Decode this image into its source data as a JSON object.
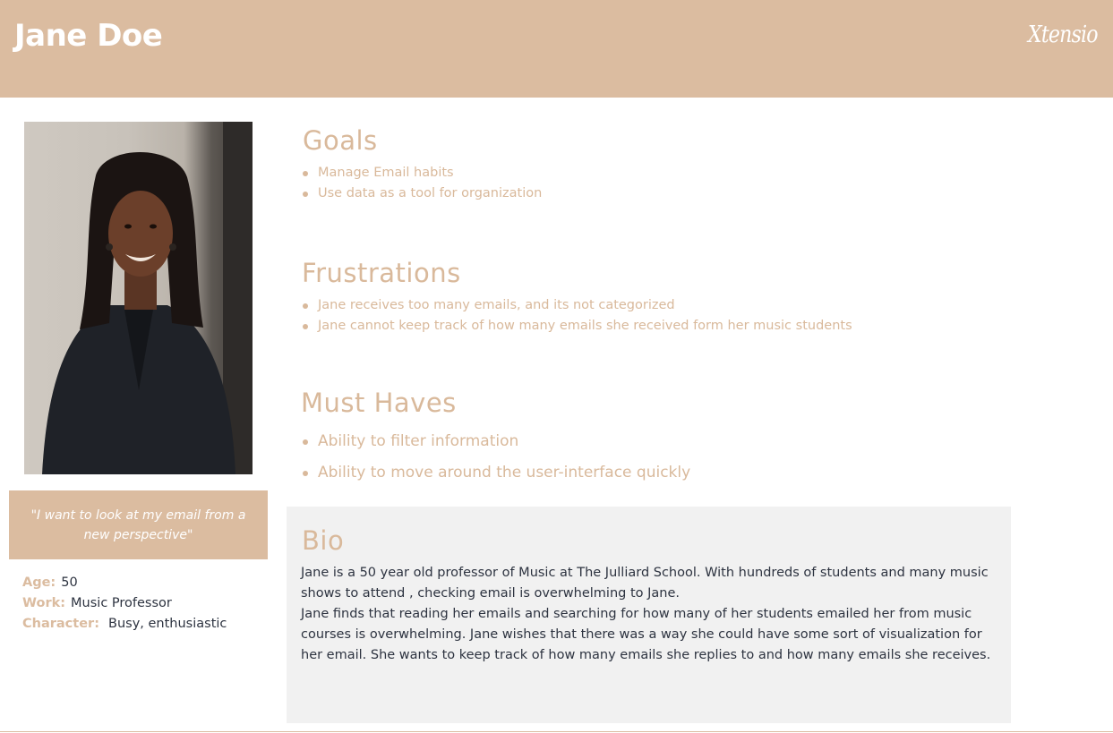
{
  "persona": {
    "name": "Jane Doe",
    "logo": "Xtensio",
    "photo_icon": "portrait-photo",
    "quote": "\"I want to look at my email from a new perspective\"",
    "attributes": [
      {
        "key": "Age:",
        "value": "50"
      },
      {
        "key": "Work:",
        "value": "Music Professor"
      },
      {
        "key": "Character:",
        "value": "Busy, enthusiastic"
      }
    ]
  },
  "goals": {
    "title": "Goals",
    "items": [
      "Manage Email habits",
      "Use data as a tool for organization"
    ]
  },
  "frustrations": {
    "title": "Frustrations",
    "items": [
      "Jane receives too many emails, and its not categorized",
      "Jane cannot keep track of  how many emails she received form her music students"
    ]
  },
  "must_haves": {
    "title": "Must Haves",
    "items": [
      "Ability to filter information",
      "Ability to move around the user-interface quickly"
    ]
  },
  "bio": {
    "title": "Bio",
    "lines": [
      "Jane is a 50 year old professor of Music at The Julliard School.  With hundreds of students and many music shows to attend , checking email is overwhelming to Jane.",
      "Jane finds that reading her emails and searching for how many of her students emailed her from music courses is overwhelming. Jane wishes that there was a way she could have some sort of visualization for her email.  She wants to keep track of how many emails she replies to and how many emails she receives."
    ]
  },
  "colors": {
    "accent": "#dbbca0",
    "heading": "#d9b99b",
    "body_text": "#2d3340",
    "bio_panel": "#f1f1f1"
  }
}
